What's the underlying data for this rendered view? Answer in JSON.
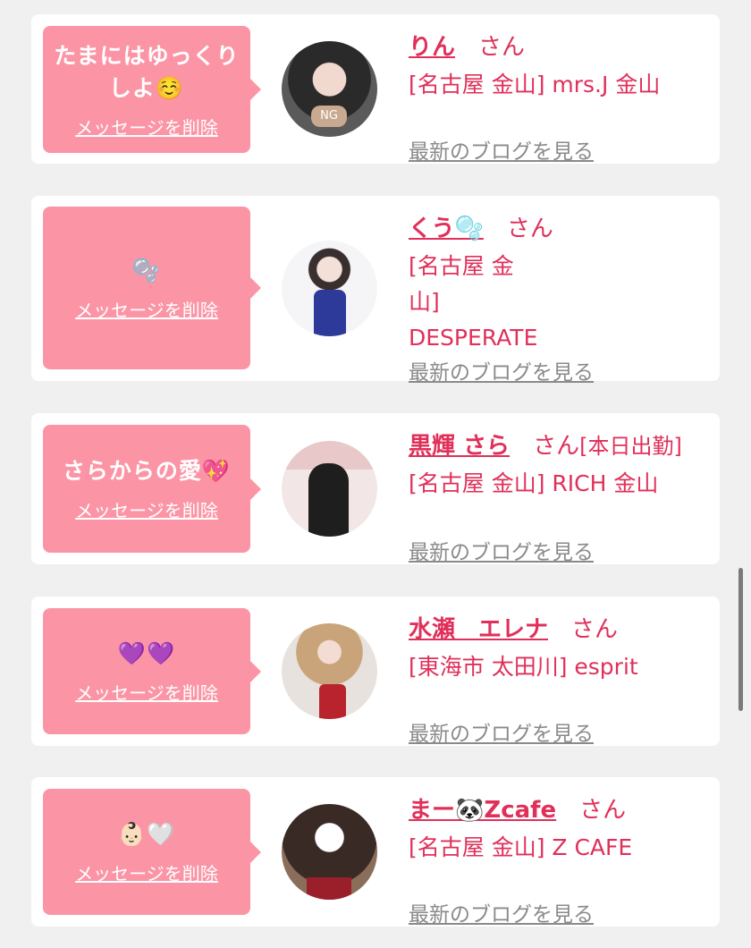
{
  "delete_label": "メッセージを削除",
  "blog_label": "最新のブログを見る",
  "san_label": "さん",
  "items": [
    {
      "message": "たまにはゆっくりしよ☺️",
      "name": "りん",
      "status": "",
      "shop": "[名古屋 金山] mrs.J 金山",
      "avatar_badge": "NG"
    },
    {
      "message": "🫧",
      "name": "くう🫧",
      "status": "",
      "shop": "[名古屋 金山] DESPERATE",
      "avatar_badge": ""
    },
    {
      "message": "さらからの愛💖",
      "name": "黒輝 さら",
      "status": "[本日出勤]",
      "shop": "[名古屋 金山] RICH 金山",
      "avatar_badge": ""
    },
    {
      "message": "💜💜",
      "name": "水瀬　エレナ",
      "status": "",
      "shop": "[東海市 太田川] esprit",
      "avatar_badge": ""
    },
    {
      "message": "👶🏻🤍",
      "name": "まー🐼Zcafe",
      "status": "",
      "shop": "[名古屋 金山] Z CAFE",
      "avatar_badge": ""
    }
  ],
  "colors": {
    "accent": "#e0305a",
    "bubble": "#fb95a6",
    "link_gray": "#8a8a8a",
    "background": "#f0f0f0"
  }
}
